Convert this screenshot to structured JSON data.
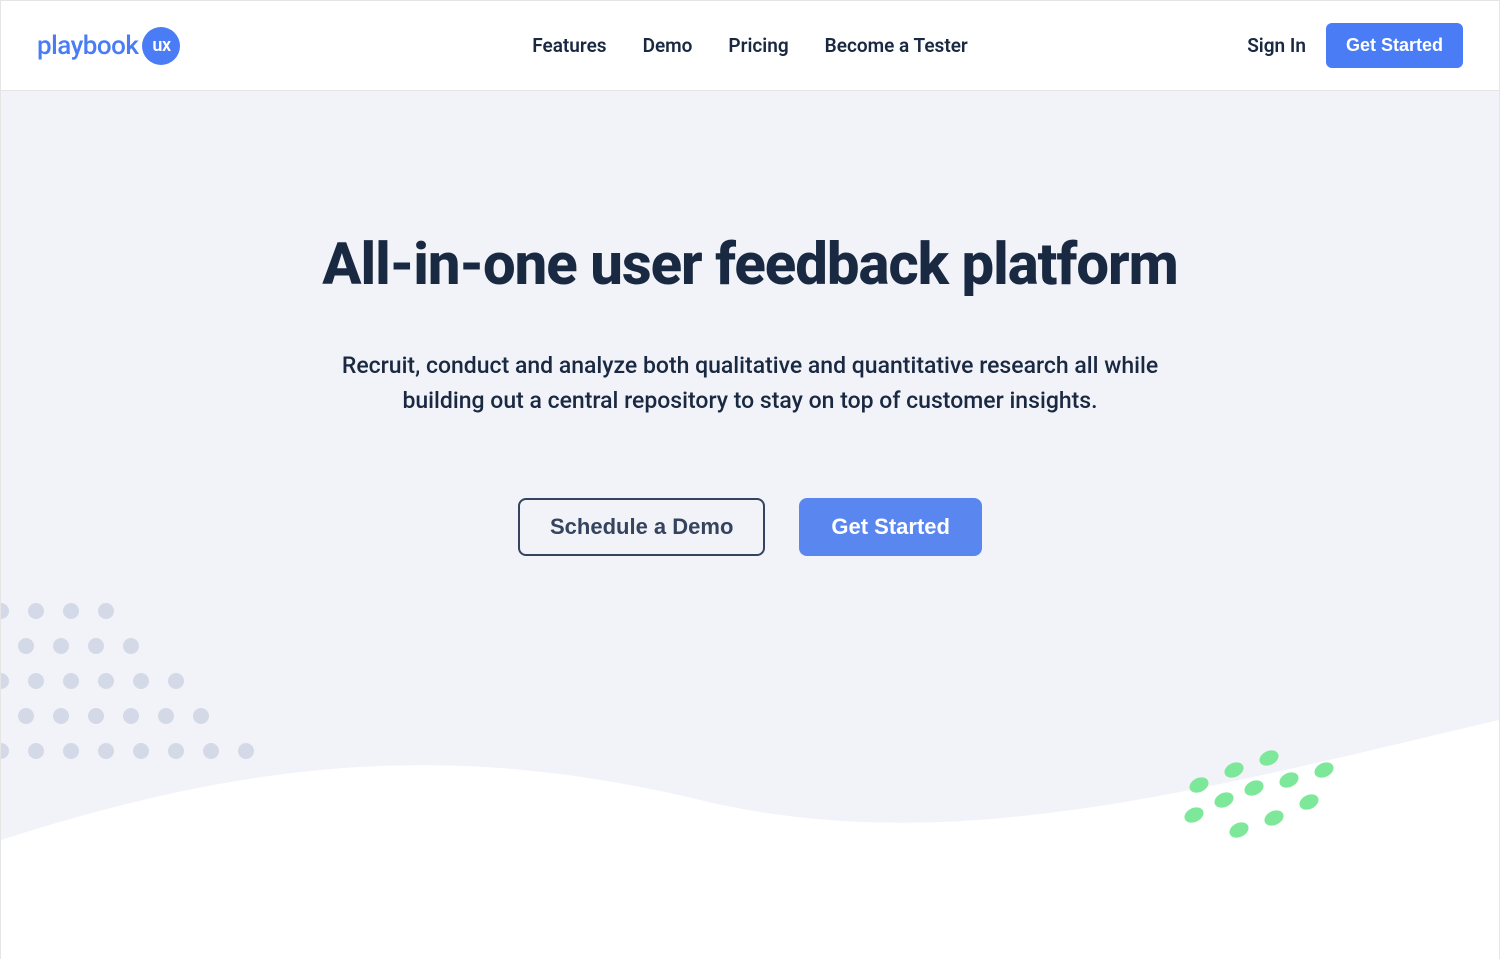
{
  "logo": {
    "text": "playbook",
    "badge": "ux"
  },
  "nav": [
    "Features",
    "Demo",
    "Pricing",
    "Become a Tester"
  ],
  "header": {
    "signin": "Sign In",
    "get_started": "Get Started"
  },
  "hero": {
    "title": "All-in-one user feedback platform",
    "subtitle": "Recruit, conduct and analyze both qualitative and quantitative research all while building out a central repository to stay on top of customer insights.",
    "schedule_demo": "Schedule a Demo",
    "get_started": "Get Started"
  }
}
